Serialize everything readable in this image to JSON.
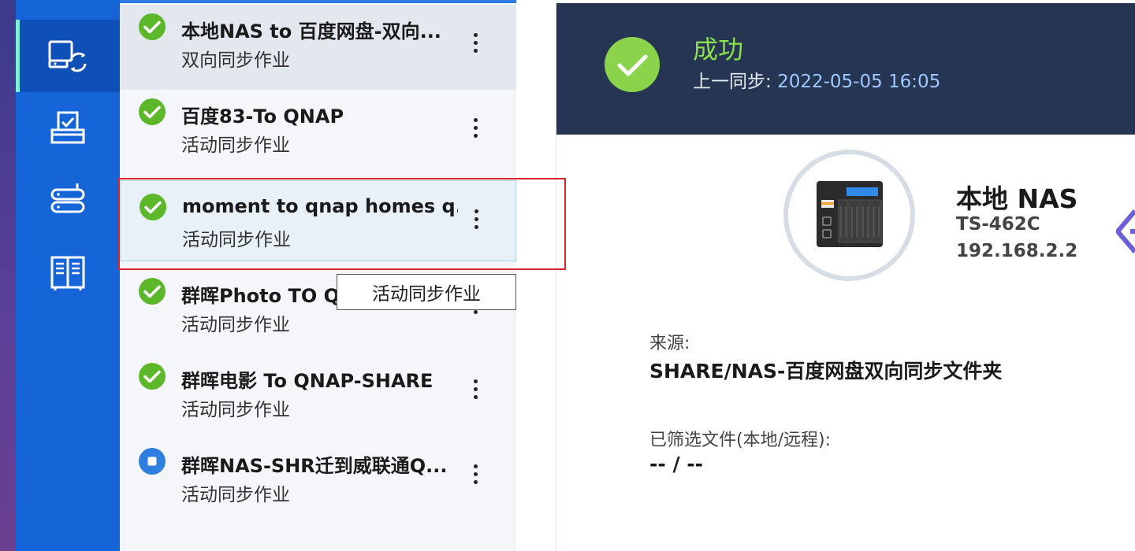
{
  "jobs": [
    {
      "name": "本地NAS to 百度网盘-双向...",
      "type": "双向同步作业",
      "status": "success"
    },
    {
      "name": "百度83-To QNAP",
      "type": "活动同步作业",
      "status": "success"
    },
    {
      "name": "moment to qnap homes q...",
      "type": "活动同步作业",
      "status": "success"
    },
    {
      "name": "群晖Photo TO Q",
      "type": "活动同步作业",
      "status": "success"
    },
    {
      "name": "群晖电影 To QNAP-SHARE",
      "type": "活动同步作业",
      "status": "success"
    },
    {
      "name": "群晖NAS-SHR迁到威联通Q...",
      "type": "活动同步作业",
      "status": "stopped"
    }
  ],
  "tooltip": "活动同步作业",
  "detail": {
    "status_title": "成功",
    "last_sync_label": "上一同步: ",
    "last_sync_time": "2022-05-05 16:05",
    "device_name": "本地 NAS",
    "device_model": "TS-462C",
    "device_ip": "192.168.2.2",
    "source_label": "来源:",
    "source_value": "SHARE/NAS-百度网盘双向同步文件夹",
    "filtered_label": "已筛选文件(本地/远程):",
    "filtered_value": "-- / --"
  },
  "colors": {
    "success": "#5cb82a",
    "stopped": "#2f7fe0",
    "nav": "#1565d8",
    "banner": "#253552",
    "highlight": "#d9262e"
  }
}
